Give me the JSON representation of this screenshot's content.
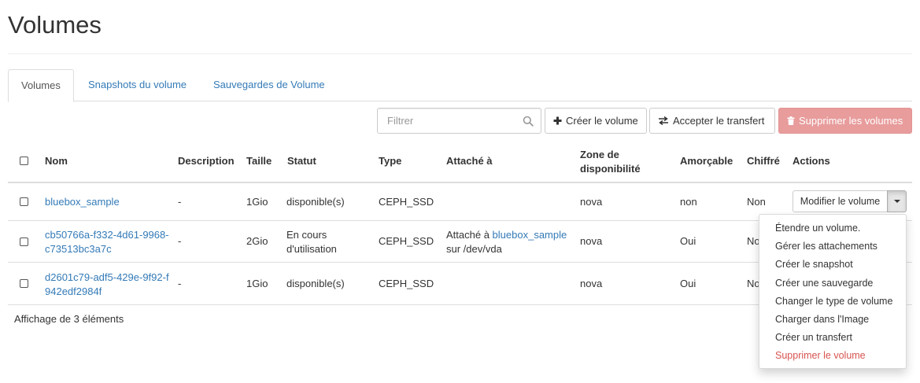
{
  "page": {
    "title": "Volumes"
  },
  "tabs": [
    {
      "label": "Volumes",
      "active": true
    },
    {
      "label": "Snapshots du volume",
      "active": false
    },
    {
      "label": "Sauvegardes de Volume",
      "active": false
    }
  ],
  "toolbar": {
    "filter_placeholder": "Filtrer",
    "create_label": "Créer le volume",
    "accept_transfer_label": "Accepter le transfert",
    "delete_label": "Supprimer les volumes"
  },
  "table": {
    "headers": {
      "name": "Nom",
      "description": "Description",
      "size": "Taille",
      "status": "Statut",
      "type": "Type",
      "attached": "Attaché à",
      "zone_line1": "Zone de",
      "zone_line2": "disponibilité",
      "bootable": "Amorçable",
      "encrypted": "Chiffré",
      "actions": "Actions"
    },
    "rows": [
      {
        "name_line1": "bluebox_sample",
        "name_line2": "",
        "description": "-",
        "size": "1Gio",
        "status_line1": "disponible(s)",
        "status_line2": "",
        "type": "CEPH_SSD",
        "attached_prefix": "",
        "attached_link": "",
        "attached_suffix": "",
        "zone": "nova",
        "bootable": "non",
        "encrypted": "Non",
        "action_label": "Modifier le volume"
      },
      {
        "name_line1": "cb50766a-f332-4d61-9968-",
        "name_line2": "c73513bc3a7c",
        "description": "-",
        "size": "2Gio",
        "status_line1": "En cours",
        "status_line2": "d'utilisation",
        "type": "CEPH_SSD",
        "attached_prefix": "Attaché à ",
        "attached_link": "bluebox_sample",
        "attached_suffix": "sur /dev/vda",
        "zone": "nova",
        "bootable": "Oui",
        "encrypted": "No"
      },
      {
        "name_line1": "d2601c79-adf5-429e-9f92-f",
        "name_line2": "942edf2984f",
        "description": "-",
        "size": "1Gio",
        "status_line1": "disponible(s)",
        "status_line2": "",
        "type": "CEPH_SSD",
        "attached_prefix": "",
        "attached_link": "",
        "attached_suffix": "",
        "zone": "nova",
        "bootable": "Oui",
        "encrypted": "No"
      }
    ],
    "footer": "Affichage de 3 éléments"
  },
  "dropdown": {
    "items": [
      {
        "label": "Étendre un volume.",
        "danger": false
      },
      {
        "label": "Gérer les attachements",
        "danger": false
      },
      {
        "label": "Créer le snapshot",
        "danger": false
      },
      {
        "label": "Créer une sauvegarde",
        "danger": false
      },
      {
        "label": "Changer le type de volume",
        "danger": false
      },
      {
        "label": "Charger dans l'Image",
        "danger": false
      },
      {
        "label": "Créer un transfert",
        "danger": false
      },
      {
        "label": "Supprimer le volume",
        "danger": true
      }
    ]
  },
  "icons": {
    "search": "search-icon",
    "plus": "plus-icon",
    "transfer": "transfer-arrows-icon",
    "trash": "trash-icon",
    "caret": "caret-down-icon"
  }
}
